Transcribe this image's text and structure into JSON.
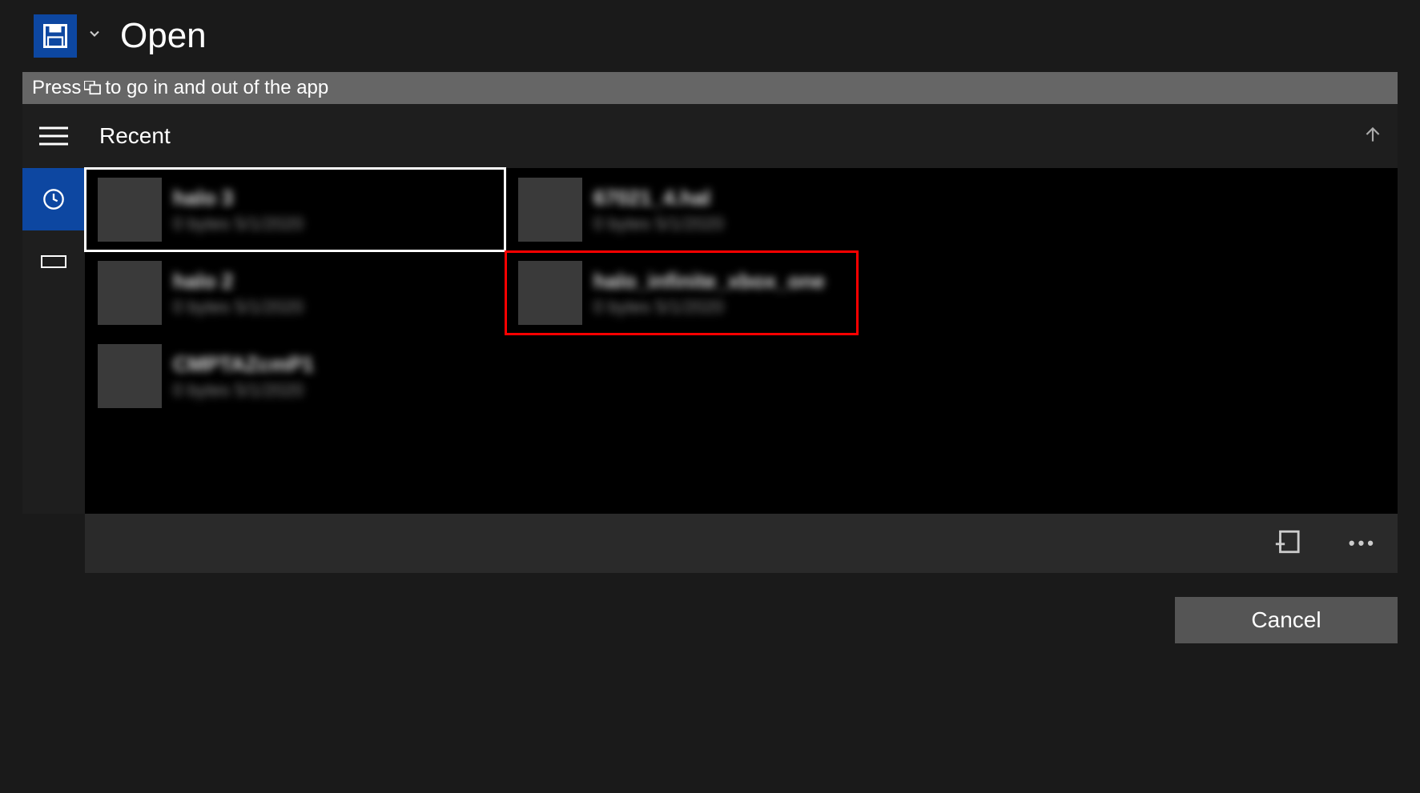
{
  "title": "Open",
  "hint": {
    "prefix": "Press ",
    "suffix": " to go in and out of the app"
  },
  "panel_title": "Recent",
  "files": [
    {
      "name": "halo 3",
      "meta": "0 bytes 5/1/2020",
      "selected": true
    },
    {
      "name": "67021_4.hal",
      "meta": "0 bytes 5/1/2020"
    },
    {
      "name": "halo 2",
      "meta": "0 bytes 5/1/2020"
    },
    {
      "name": "halo_infinite_xbox_one",
      "meta": "0 bytes 5/1/2020",
      "highlighted": true
    },
    {
      "name": "CMPTAZcmP1",
      "meta": "0 bytes 5/1/2020"
    }
  ],
  "cancel_label": "Cancel"
}
